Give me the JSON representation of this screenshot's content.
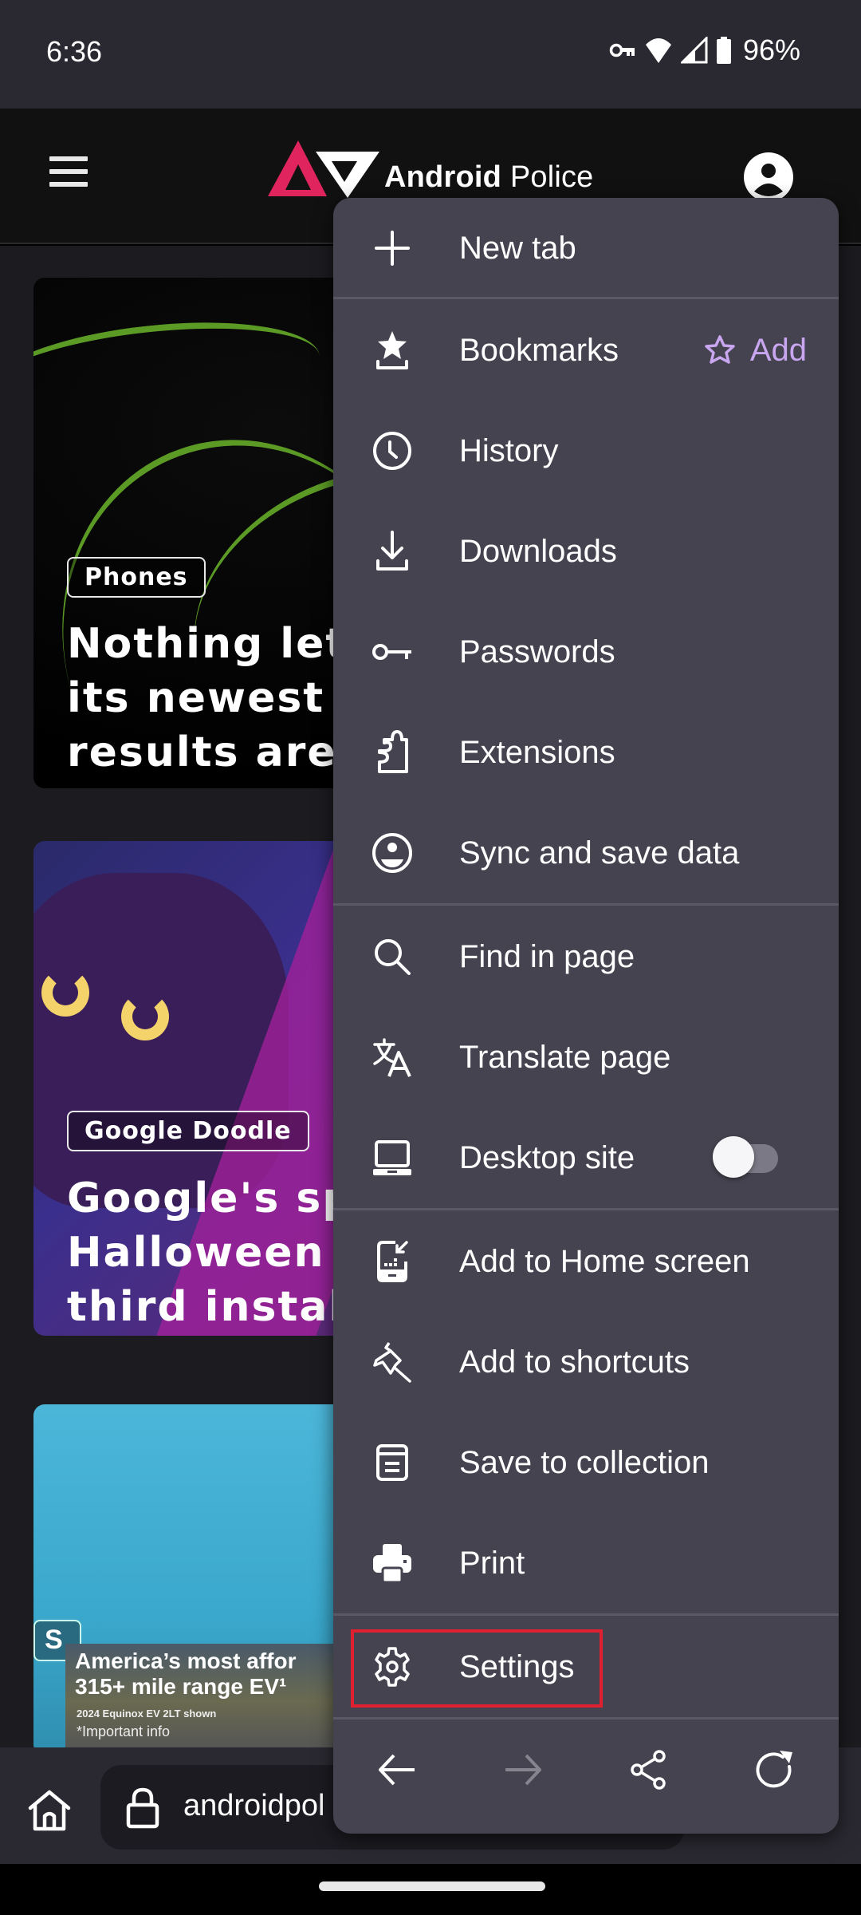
{
  "status_bar": {
    "time": "6:36",
    "icons": [
      "vpn-key-icon",
      "wifi-icon",
      "signal-icon",
      "battery-icon"
    ],
    "battery_percent": "96%"
  },
  "site_header": {
    "logo_bold": "Android",
    "logo_light": "Police",
    "menu_icon": "hamburger-icon",
    "account_icon": "account-circle-icon"
  },
  "articles": [
    {
      "tag": "Phones",
      "title_lines": [
        "Nothing let c",
        "its newest p",
        "results are g"
      ]
    },
    {
      "tag": "Google Doodle",
      "title_lines": [
        "Google's spe",
        "Halloween D",
        "third installn"
      ]
    },
    {
      "tag": "S"
    }
  ],
  "ad": {
    "line1": "America’s most affor",
    "line2": "315+ mile range EV¹",
    "line3": "2024 Equinox EV 2LT shown",
    "line4": "*Important info"
  },
  "bottom_bar": {
    "home_icon": "home-icon",
    "lock_icon": "lock-icon",
    "url": "androidpol"
  },
  "menu": {
    "items": [
      {
        "label": "New tab",
        "icon": "plus-icon"
      },
      {
        "label": "Bookmarks",
        "icon": "bookmarks-icon"
      },
      {
        "label": "History",
        "icon": "history-clock-icon"
      },
      {
        "label": "Downloads",
        "icon": "download-icon"
      },
      {
        "label": "Passwords",
        "icon": "key-icon"
      },
      {
        "label": "Extensions",
        "icon": "puzzle-icon"
      },
      {
        "label": "Sync and save data",
        "icon": "account-sync-icon"
      },
      {
        "label": "Find in page",
        "icon": "search-icon"
      },
      {
        "label": "Translate page",
        "icon": "translate-icon"
      },
      {
        "label": "Desktop site",
        "icon": "laptop-icon"
      },
      {
        "label": "Add to Home screen",
        "icon": "add-to-home-icon"
      },
      {
        "label": "Add to shortcuts",
        "icon": "pin-icon"
      },
      {
        "label": "Save to collection",
        "icon": "collection-icon"
      },
      {
        "label": "Print",
        "icon": "print-icon"
      },
      {
        "label": "Settings",
        "icon": "gear-icon"
      }
    ],
    "bookmark_add_label": "Add",
    "desktop_site_enabled": false,
    "accent_color": "#c9a6f0",
    "highlight_color": "#e02030",
    "nav_buttons": [
      "back-arrow-icon",
      "forward-arrow-icon",
      "share-icon",
      "reload-icon"
    ],
    "forward_enabled": false
  }
}
